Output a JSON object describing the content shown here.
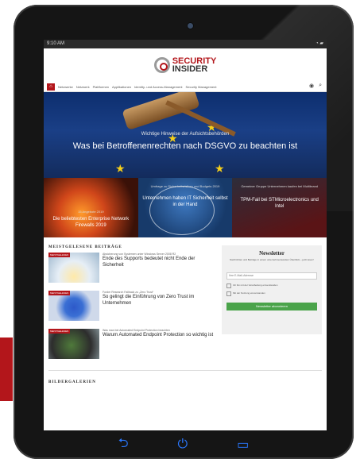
{
  "status": {
    "time": "9:10 AM",
    "system_icons": "◔ ▰"
  },
  "site": {
    "logo_line1": "SECURITY",
    "logo_line2": "INSIDER"
  },
  "nav": {
    "items": [
      "Netzwerke",
      "Netzwerk",
      "Plattformen",
      "Applikationen",
      "Identity- und Access-Management",
      "Security Management"
    ]
  },
  "hero": {
    "eyebrow": "Wichtige Hinweise der Aufsichtsbehörden",
    "headline": "Was bei Betroffenenrechten nach DSGVO zu beachten ist"
  },
  "tiles": [
    {
      "tag": "15 Angebote 2019",
      "title": "Die beliebtesten Enterprise Network Firewalls 2019"
    },
    {
      "tag": "Umfrage zu Sicherheitsrisiken und Budgets 2019",
      "title": "Unternehmen haben IT Sicherheit selbst in der Hand"
    },
    {
      "tag": "Gemeiner Gruppe Unternehmen kaufen bei Multibrand",
      "title": "TPM-Fail bei STMicroelectronics und Intel"
    }
  ],
  "most_read": {
    "heading": "MEISTGELESENE BEITRÄGE",
    "articles": [
      {
        "badge": "MEISTGELESEN",
        "kicker": "Absicherung von Systemen unter Windows Server 2008 R2",
        "title": "Ende des Supports bedeutet nicht Ende der Sicherheit"
      },
      {
        "badge": "MEISTGELESEN",
        "kicker": "Forder Research Fallback zu „Zero Trust“",
        "title": "So gelingt die Einführung von Zero Trust im Unternehmen"
      },
      {
        "badge": "MEISTGELESEN",
        "kicker": "Was man bei Automated Endpoint Protection beachten",
        "title": "Warum Automated Endpoint Protection so wichtig ist"
      }
    ]
  },
  "newsletter": {
    "heading": "Newsletter",
    "subtitle": "Nachrichten und Beiträge in einem unternehmensweiten Überblick – jetzt lesen!",
    "email_placeholder": "Ihre E-Mail-Adresse",
    "consent1": "Ich bin mit der Verarbeitung einverstanden",
    "consent2": "Mit der Nutzung einverstanden",
    "button": "Newsletter abonnieren"
  },
  "gallery": {
    "heading": "BILDERGALERIEN"
  },
  "device_nav": {
    "back": "⮌",
    "home": "⏻",
    "recents": "▭"
  }
}
